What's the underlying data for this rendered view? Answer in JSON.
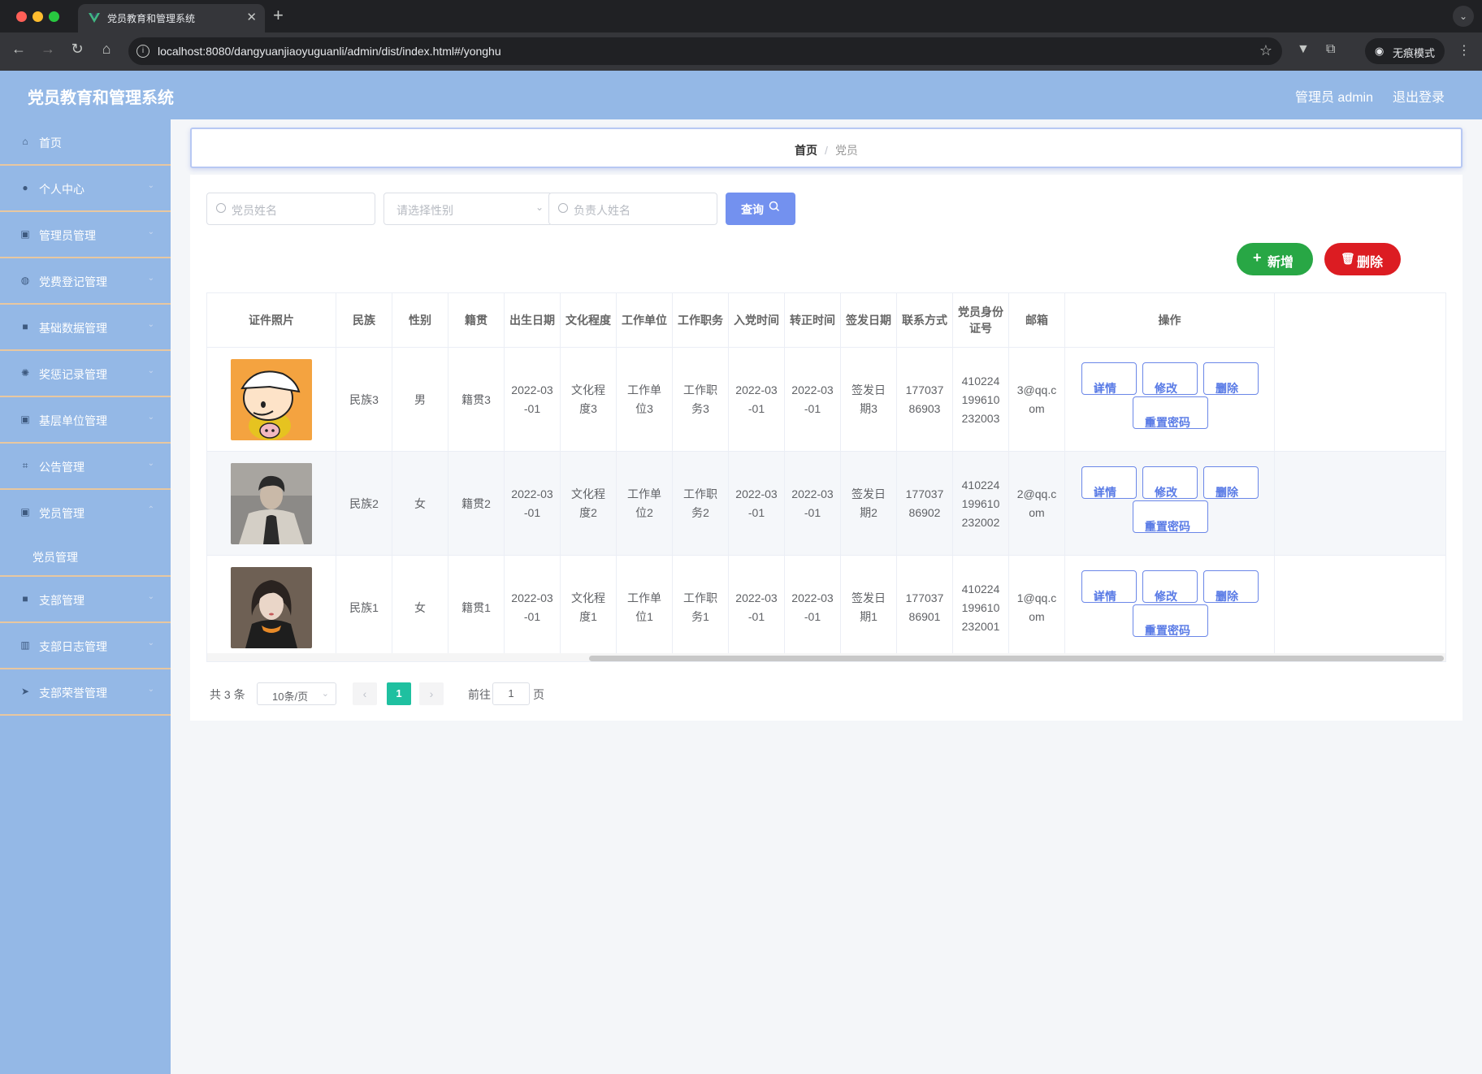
{
  "browser": {
    "tab_title": "党员教育和管理系统",
    "url": "localhost:8080/dangyuanjiaoyuguanli/admin/dist/index.html#/yonghu",
    "incognito_label": "无痕模式"
  },
  "header": {
    "title": "党员教育和管理系统",
    "user": "管理员 admin",
    "logout": "退出登录"
  },
  "sidebar": {
    "items": [
      {
        "label": "首页",
        "icon": "home-icon"
      },
      {
        "label": "个人中心",
        "icon": "user-icon"
      },
      {
        "label": "管理员管理",
        "icon": "clipboard-icon"
      },
      {
        "label": "党费登记管理",
        "icon": "badge-icon"
      },
      {
        "label": "基础数据管理",
        "icon": "briefcase-icon"
      },
      {
        "label": "奖惩记录管理",
        "icon": "settings-icon"
      },
      {
        "label": "基层单位管理",
        "icon": "clipboard-icon"
      },
      {
        "label": "公告管理",
        "icon": "crop-icon"
      },
      {
        "label": "党员管理",
        "icon": "clipboard-icon"
      },
      {
        "label": "支部管理",
        "icon": "briefcase-icon"
      },
      {
        "label": "支部日志管理",
        "icon": "chart-icon"
      },
      {
        "label": "支部荣誉管理",
        "icon": "send-icon"
      }
    ],
    "sub_item": "党员管理"
  },
  "breadcrumb": {
    "home": "首页",
    "current": "党员"
  },
  "search": {
    "name_placeholder": "党员姓名",
    "gender_placeholder": "请选择性别",
    "manager_placeholder": "负责人姓名",
    "query_label": "查询"
  },
  "actions": {
    "add_label": "新增",
    "delete_label": "删除"
  },
  "table": {
    "headers": [
      "证件照片",
      "民族",
      "性别",
      "籍贯",
      "出生日期",
      "文化程度",
      "工作单位",
      "工作职务",
      "入党时间",
      "转正时间",
      "签发日期",
      "联系方式",
      "党员身份证号",
      "邮箱",
      "操作"
    ],
    "rows": [
      {
        "photo": "cartoon-avatar",
        "ethnicity": "民族3",
        "gender": "男",
        "origin": "籍贯3",
        "birth": "2022-03-01",
        "education": "文化程度3",
        "unit": "工作单位3",
        "position": "工作职务3",
        "join": "2022-03-01",
        "regular": "2022-03-01",
        "issue": "签发日期3",
        "phone": "17703786903",
        "idno": "410224199610232003",
        "email": "3@qq.com"
      },
      {
        "photo": "man-photo",
        "ethnicity": "民族2",
        "gender": "女",
        "origin": "籍贯2",
        "birth": "2022-03-01",
        "education": "文化程度2",
        "unit": "工作单位2",
        "position": "工作职务2",
        "join": "2022-03-01",
        "regular": "2022-03-01",
        "issue": "签发日期2",
        "phone": "17703786902",
        "idno": "410224199610232002",
        "email": "2@qq.com"
      },
      {
        "photo": "woman-photo",
        "ethnicity": "民族1",
        "gender": "女",
        "origin": "籍贯1",
        "birth": "2022-03-01",
        "education": "文化程度1",
        "unit": "工作单位1",
        "position": "工作职务1",
        "join": "2022-03-01",
        "regular": "2022-03-01",
        "issue": "签发日期1",
        "phone": "17703786901",
        "idno": "410224199610232001",
        "email": "1@qq.com"
      }
    ],
    "op_labels": {
      "detail": "详情",
      "edit": "修改",
      "delete": "删除",
      "reset": "重置密码"
    }
  },
  "pagination": {
    "total": "共 3 条",
    "page_size": "10条/页",
    "current": "1",
    "goto_label": "前往",
    "goto_value": "1",
    "page_label": "页"
  },
  "colors": {
    "primary": "#94b8e6",
    "accent": "#7391ef",
    "success": "#28a745",
    "danger": "#dc1c22",
    "active_page": "#1fc0a0"
  }
}
